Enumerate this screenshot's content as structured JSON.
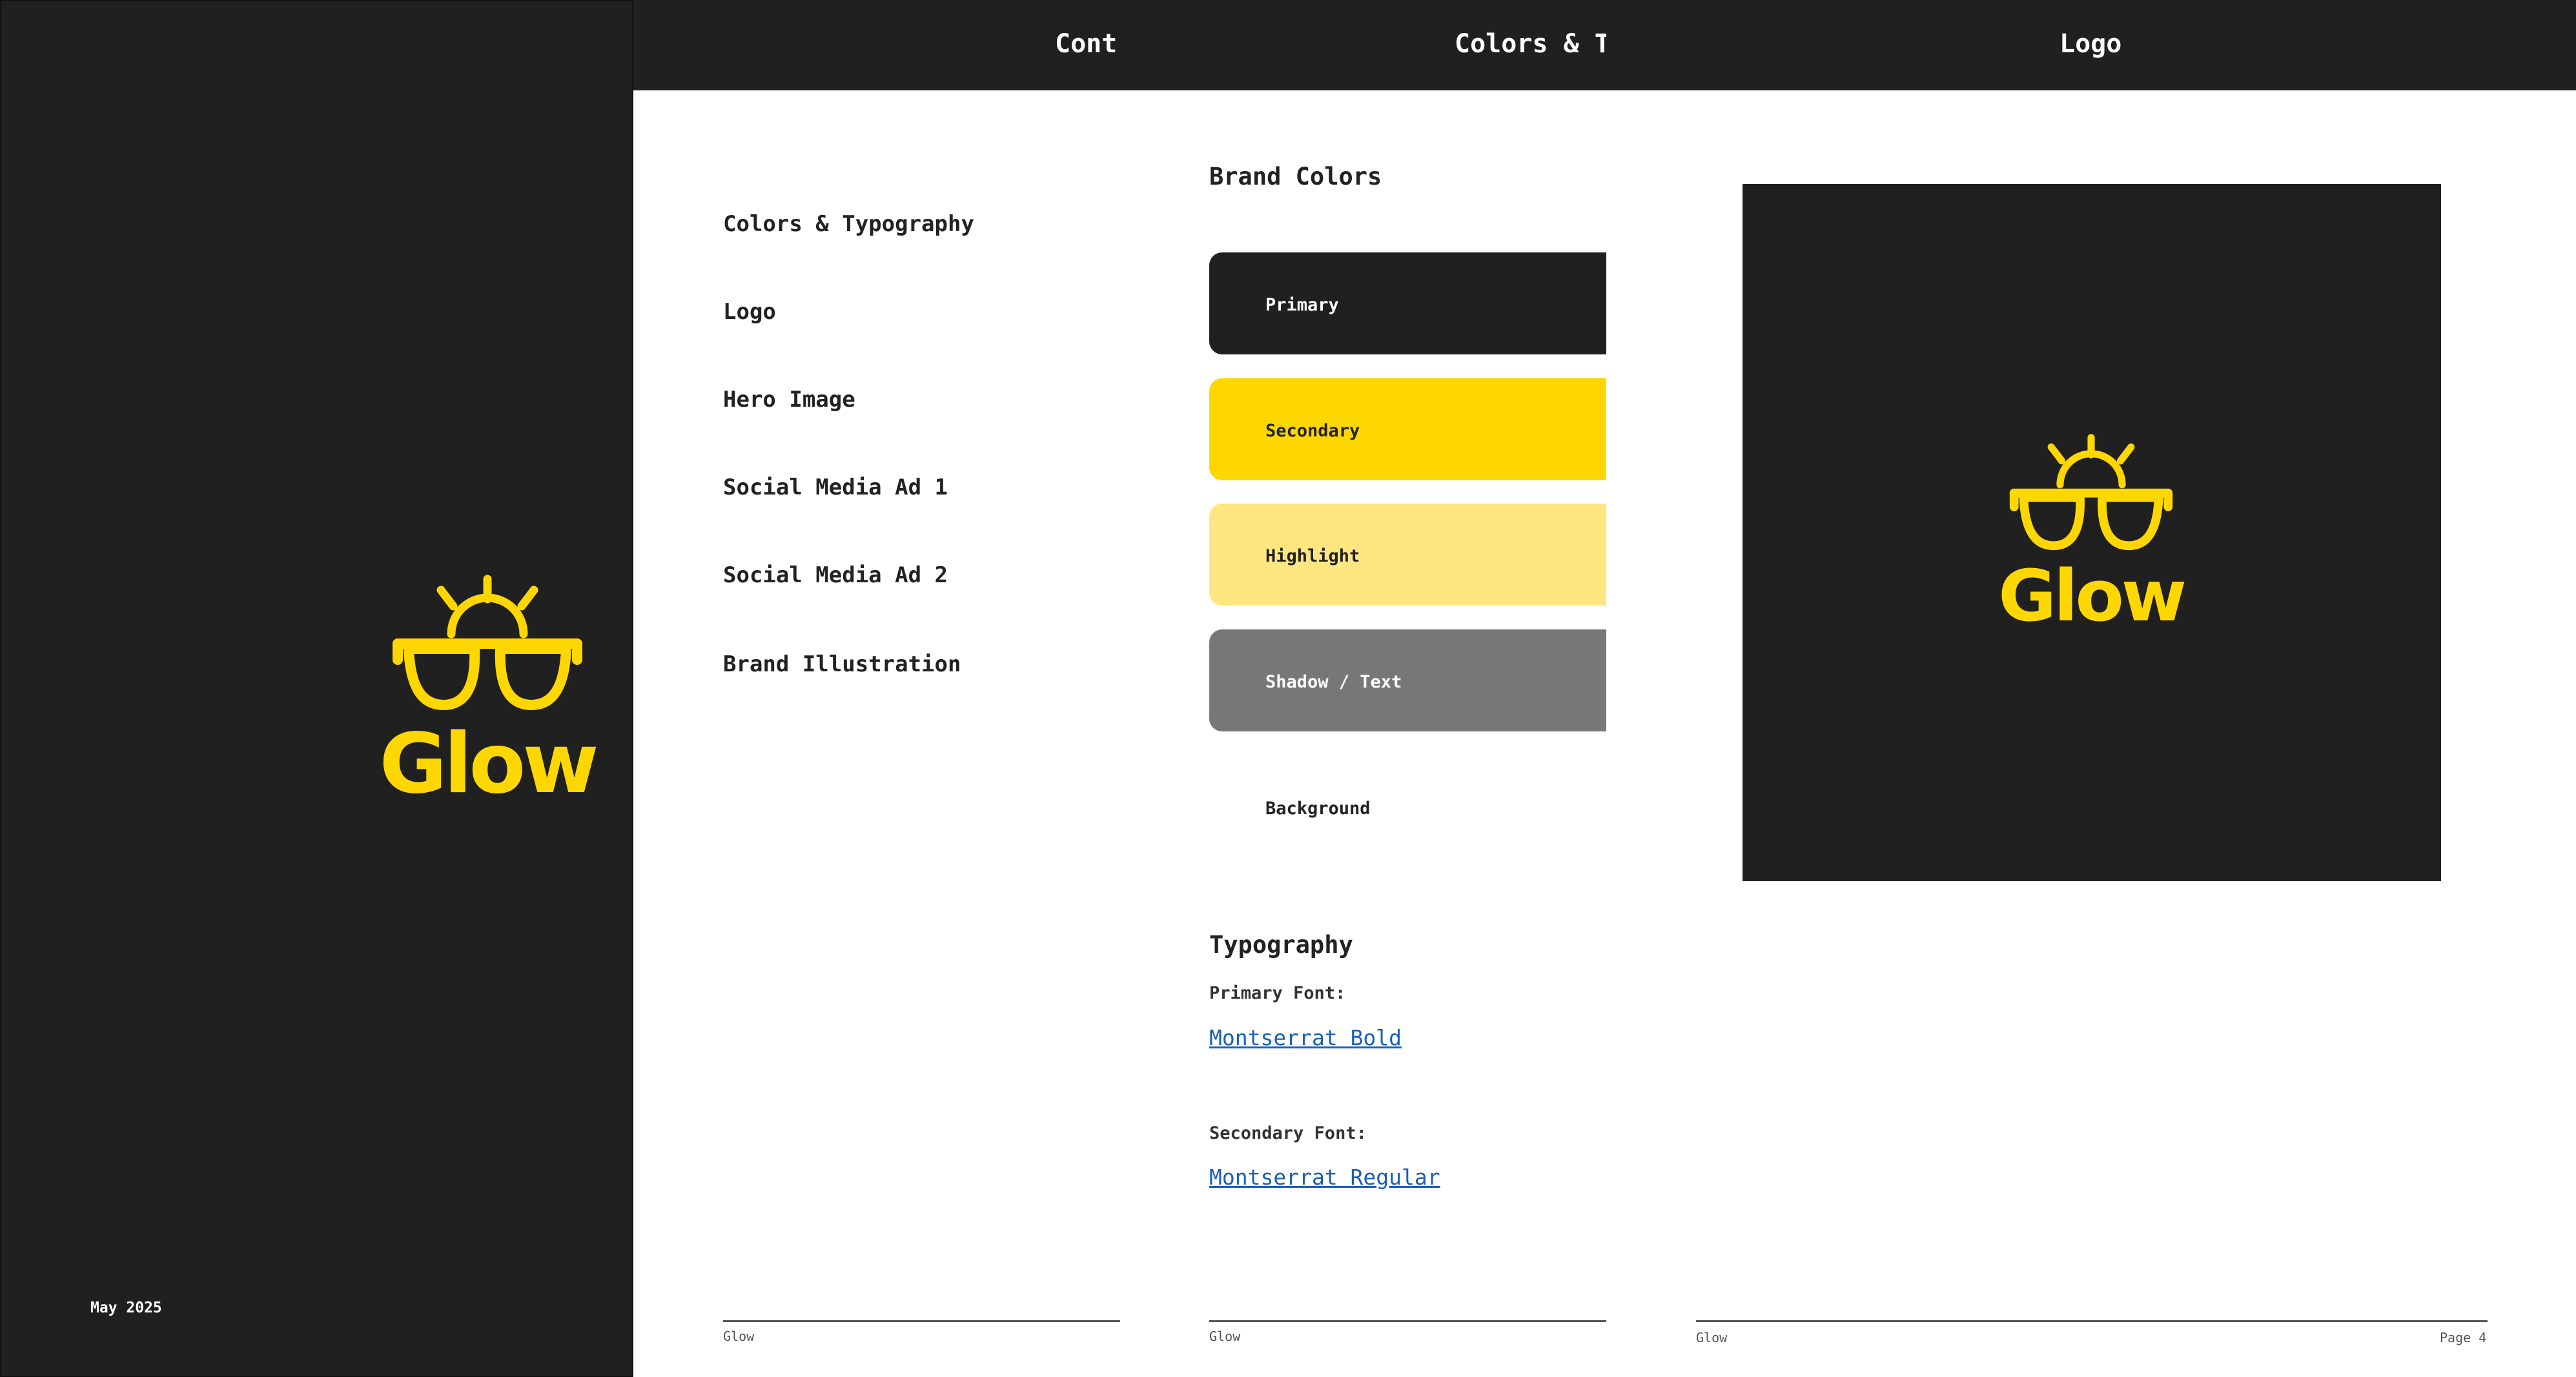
{
  "cover": {
    "brand_name": "Glow",
    "date": "May 2025"
  },
  "contents": {
    "header": "Cont",
    "items": [
      {
        "label": "Colors & Typography"
      },
      {
        "label": "Logo"
      },
      {
        "label": "Hero Image"
      },
      {
        "label": "Social Media Ad 1"
      },
      {
        "label": "Social Media Ad 2"
      },
      {
        "label": "Brand Illustration"
      }
    ],
    "footer": "Glow"
  },
  "colors_page": {
    "header": "Colors & T",
    "brand_colors_title": "Brand Colors",
    "swatches": [
      {
        "label": "Primary",
        "color": "#202020",
        "text_color": "#ffffff"
      },
      {
        "label": "Secondary",
        "color": "#FFD700",
        "text_color": "#222222"
      },
      {
        "label": "Highlight",
        "color": "#FFE680",
        "text_color": "#222222"
      },
      {
        "label": "Shadow / Text",
        "color": "#777777",
        "text_color": "#ffffff"
      },
      {
        "label": "Background",
        "color": "#FFFFFF",
        "text_color": "#222222"
      }
    ],
    "typography_title": "Typography",
    "primary_font_label": "Primary Font:",
    "primary_font": "Montserrat Bold",
    "secondary_font_label": "Secondary Font:",
    "secondary_font": "Montserrat Regular",
    "footer": "Glow"
  },
  "logo_page": {
    "header": "Logo",
    "logo_text": "Glow",
    "footer": "Glow",
    "page_number": "Page 4"
  },
  "colors": {
    "dark": "#202020",
    "brand_yellow": "#FFD700",
    "link_blue": "#1a5fb4"
  }
}
